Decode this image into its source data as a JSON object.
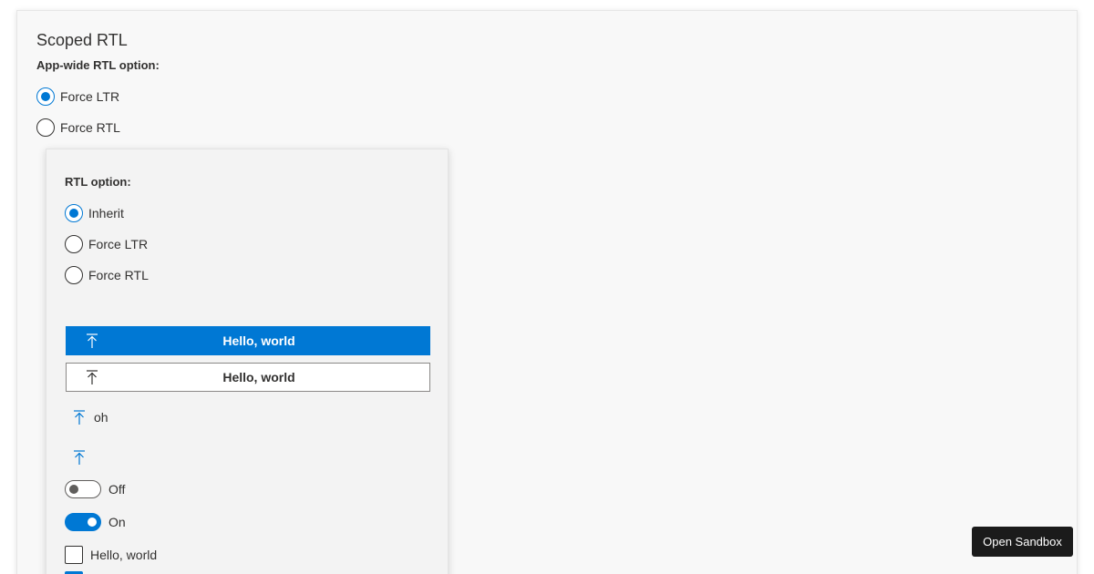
{
  "page": {
    "title": "Scoped RTL",
    "app_rtl_label": "App-wide RTL option:",
    "app_rtl_options": [
      {
        "label": "Force LTR",
        "checked": true
      },
      {
        "label": "Force RTL",
        "checked": false
      }
    ]
  },
  "scoped": {
    "rtl_label": "RTL option:",
    "rtl_options": [
      {
        "label": "Inherit",
        "checked": true
      },
      {
        "label": "Force LTR",
        "checked": false
      },
      {
        "label": "Force RTL",
        "checked": false
      }
    ],
    "primary_button": {
      "label": "Hello, world",
      "icon": "upload-arrow-icon"
    },
    "default_button": {
      "label": "Hello, world",
      "icon": "upload-arrow-icon"
    },
    "action_button": {
      "label": "oh",
      "icon": "upload-arrow-icon"
    },
    "icon_button": {
      "icon": "upload-arrow-icon"
    },
    "toggle_off": {
      "label": "Off",
      "on": false
    },
    "toggle_on": {
      "label": "On",
      "on": true
    },
    "checkbox": {
      "label": "Hello, world",
      "checked": false
    },
    "checkbox_2": {
      "checked": true
    }
  },
  "sandbox": {
    "label": "Open Sandbox"
  },
  "colors": {
    "accent": "#0078d4",
    "text": "#323130",
    "sandbox_bg": "#1b1b1b"
  }
}
